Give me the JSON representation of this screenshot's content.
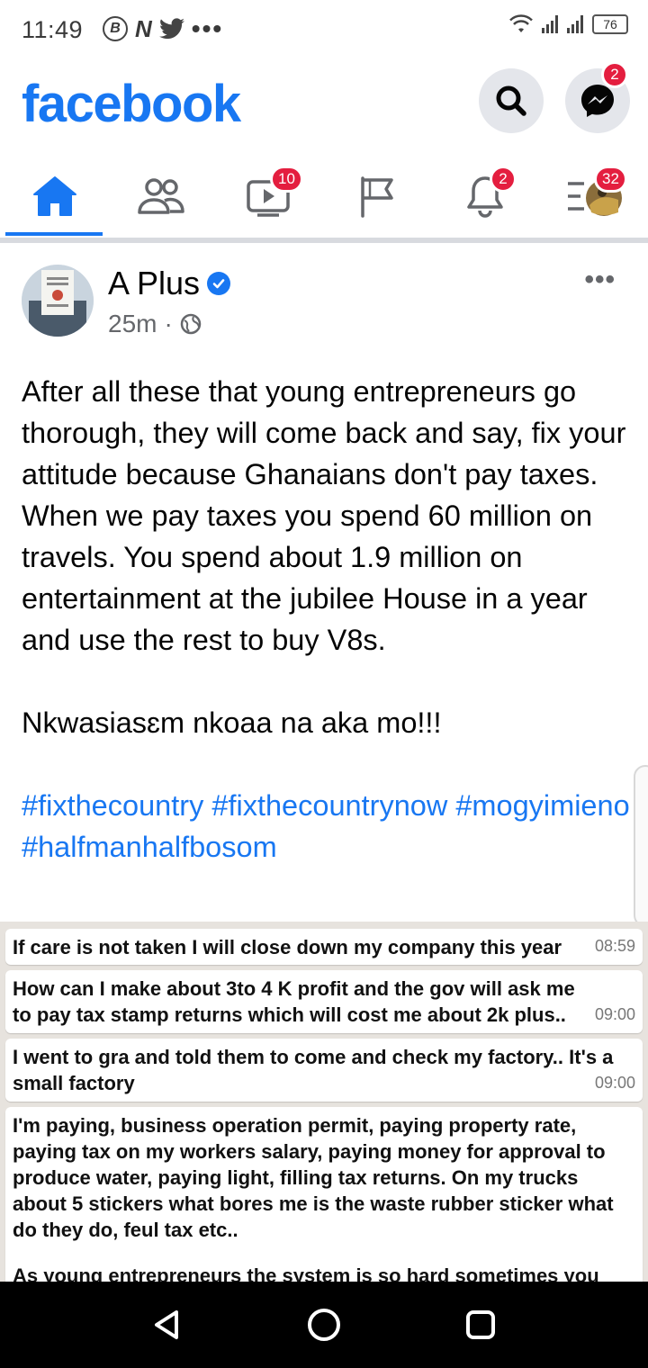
{
  "status_bar": {
    "time": "11:49",
    "left_icons": [
      "b-circle-icon",
      "n-app-icon",
      "twitter-icon",
      "more-dots-icon"
    ],
    "battery": "76"
  },
  "header": {
    "logo": "facebook",
    "messenger_badge": "2",
    "brand_color": "#1877f2"
  },
  "tabs": {
    "items": [
      {
        "name": "home",
        "icon": "home-icon",
        "active": true
      },
      {
        "name": "friends",
        "icon": "friends-icon"
      },
      {
        "name": "watch",
        "icon": "video-icon",
        "badge": "10"
      },
      {
        "name": "pages",
        "icon": "flag-icon"
      },
      {
        "name": "notifications",
        "icon": "bell-icon",
        "badge": "2"
      },
      {
        "name": "menu",
        "icon": "menu-icon",
        "badge": "32"
      }
    ]
  },
  "post": {
    "author": "A Plus",
    "time": "25m",
    "paragraph1": "After all these that young entrepreneurs go thorough, they will come back and say, fix your attitude because Ghanaians don't pay taxes. When we pay taxes you spend 60 million on travels. You spend about 1.9 million on entertainment at the jubilee House in a year and use the rest to buy V8s.",
    "paragraph2": "Nkwasiasɛm nkoaa na aka mo!!!",
    "hashtags": [
      "#fixthecountry",
      "#fixthecountrynow",
      "#mogyimieno",
      "#halfmanhalfbosom"
    ]
  },
  "chat_messages": [
    {
      "text": "If care is not taken I will close down my company this year",
      "time": "08:59"
    },
    {
      "text": "How can I make about 3to 4 K profit and the gov will ask me to pay tax stamp returns which will cost me about 2k plus..",
      "time": "09:00"
    },
    {
      "text": "I went to gra and told them to come and check my factory.. It's a small factory",
      "time": "09:00"
    },
    {
      "text": "I'm paying, business operation permit, paying property rate, paying tax on my workers salary, paying money for approval to produce water, paying light, filling tax returns. On my trucks about 5 stickers what bores me is the waste rubber sticker what do they do, feul tax etc..",
      "time": ""
    },
    {
      "text": "As young entrepreneurs the system is so hard sometimes you",
      "time": ""
    }
  ]
}
